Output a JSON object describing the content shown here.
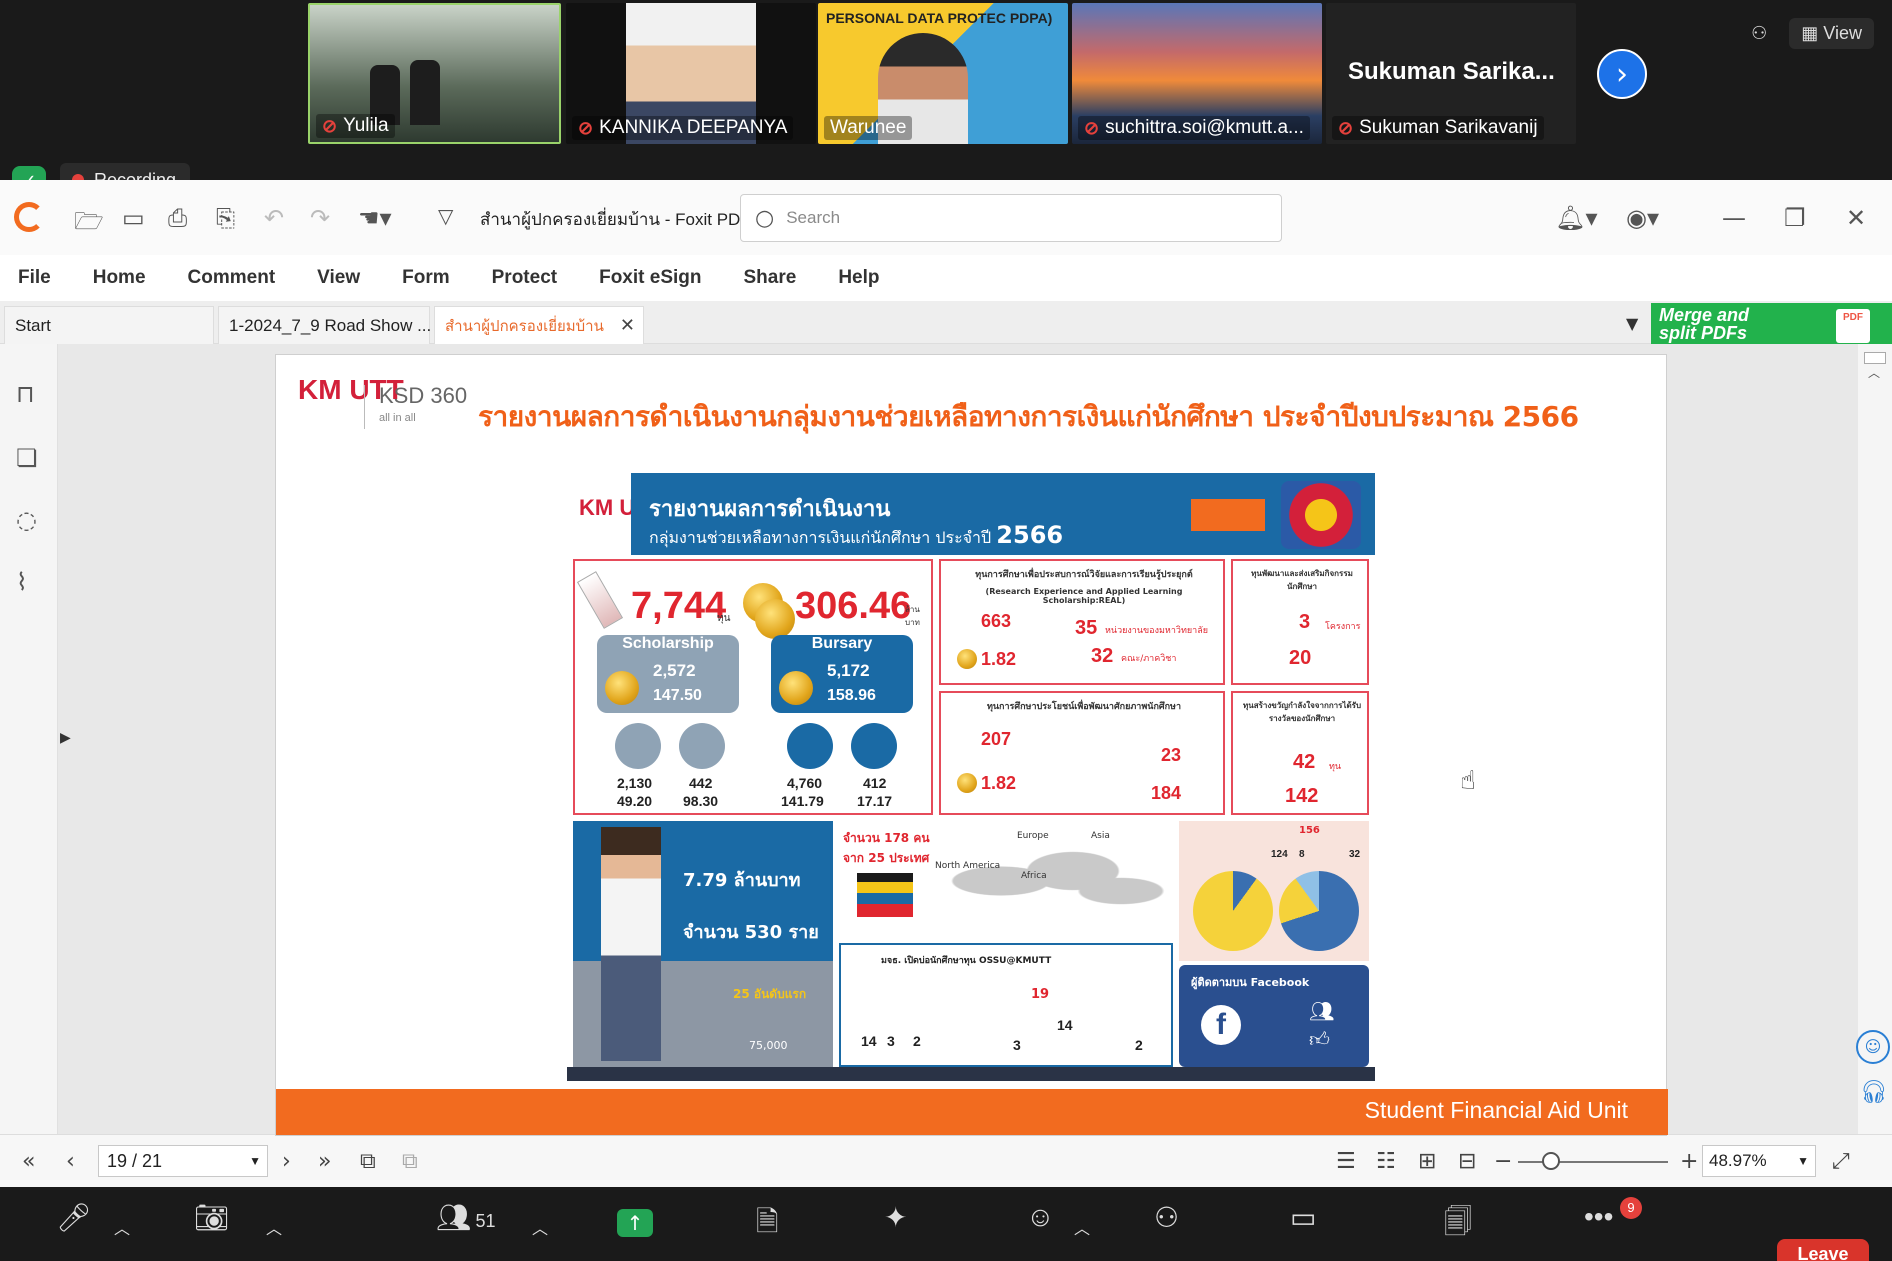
{
  "gallery": {
    "participants": [
      {
        "name": "Yulila"
      },
      {
        "name": "KANNIKA DEEPANYA"
      },
      {
        "name": "Warunee",
        "overlay": "PERSONAL DATA PROTEC PDPA)"
      },
      {
        "name": "suchittra.soi@kmutt.a..."
      },
      {
        "name": "Sukuman Sarikavanij",
        "display_name": "Sukuman  Sarika..."
      }
    ],
    "view_label": "View"
  },
  "recording": {
    "label": "Recording"
  },
  "app": {
    "doc_title": "สำนาผู้ปกครองเยี่ยมบ้าน - Foxit PDF...",
    "search_placeholder": "Search"
  },
  "menu": [
    "File",
    "Home",
    "Comment",
    "View",
    "Form",
    "Protect",
    "Foxit eSign",
    "Share",
    "Help"
  ],
  "tabs": [
    {
      "label": "Start"
    },
    {
      "label": "1-2024_7_9 Road Show ..."
    },
    {
      "label": "สำนาผู้ปกครองเยี่ยมบ้าน",
      "active": true
    }
  ],
  "promo": {
    "line1": "Merge and",
    "line2": "split PDFs",
    "icon_text": "PDF"
  },
  "page": {
    "kmutt_logo": "KM UTT",
    "ksd_logo": "KSD 360",
    "ksd_tagline": "all in all",
    "heading": "รายงานผลการดำเนินงานกลุ่มงานช่วยเหลือทางการเงินแก่นักศึกษา ประจำปีงบประมาณ 2566",
    "footer": "Student Financial Aid Unit"
  },
  "infographic": {
    "logo": "KM UTT",
    "banner_title": "รายงานผลการดำเนินงาน",
    "banner_sub": "กลุ่มงานช่วยเหลือทางการเงินแก่นักศึกษา ประจำปี",
    "banner_year": "2566",
    "total_count": "7,744",
    "total_unit": "ทุน",
    "total_amount": "306.46",
    "amount_unit": "ล้านบาท",
    "scholarship": {
      "label": "Scholarship",
      "count": "2,572",
      "amount": "147.50"
    },
    "bursary": {
      "label": "Bursary",
      "count": "5,172",
      "amount": "158.96"
    },
    "scholar_split": [
      {
        "count": "2,130",
        "amount": "49.20"
      },
      {
        "count": "442",
        "amount": "98.30"
      }
    ],
    "bursary_split": [
      {
        "count": "4,760",
        "amount": "141.79"
      },
      {
        "count": "412",
        "amount": "17.17"
      }
    ],
    "real": {
      "title": "ทุนการศึกษาเพื่อประสบการณ์วิจัยและการเรียนรู้ประยุกต์",
      "subtitle": "(Research Experience and Applied Learning Scholarship:REAL)",
      "count": "663",
      "amount": "1.82",
      "units": "35",
      "units_label": "หน่วยงานของมหาวิทยาลัย",
      "depts": "32",
      "depts_label": "คณะ/ภาควิชา"
    },
    "talent": {
      "title": "ทุนการศึกษาประโยชน์เพื่อพัฒนาศักยภาพนักศึกษา",
      "count": "207",
      "amount": "1.82",
      "activities": "23",
      "rewards": "184"
    },
    "develop": {
      "title": "ทุนพัฒนาและส่งเสริมกิจกรรมนักศึกษา",
      "a": "3",
      "b": "20",
      "unit": "โครงการ"
    },
    "motivation": {
      "title": "ทุนสร้างขวัญกำลังใจจากการได้รับรางวัลของนักศึกษา",
      "a": "42",
      "b": "142",
      "unit": "ทุน"
    },
    "loan": {
      "amount": "7.79 ล้านบาท",
      "people": "จำนวน 530 ราย",
      "debt": "25 อันดับแรก",
      "total": "75,000"
    },
    "intl": {
      "students": "จำนวน 178 คน",
      "countries": "จาก 25 ประเทศ",
      "regions": [
        "North America",
        "Europe",
        "Asia",
        "Africa"
      ]
    },
    "club": {
      "title": "มจธ. เปิดบ่อนักศึกษาทุน OSSU@KMUTT",
      "count": "19",
      "a": "14",
      "b": "3",
      "c": "2",
      "d": "14",
      "e": "3",
      "f": "2"
    },
    "survey": {
      "count": "156",
      "pie1": [
        "124",
        "8"
      ],
      "pie2": [
        "32"
      ]
    },
    "facebook": {
      "label": "ผู้ติดตามบน Facebook"
    }
  },
  "statusbar": {
    "page": "19 / 21",
    "zoom": "48.97%"
  },
  "zoom_controls": {
    "participants_count": "51",
    "more_badge": "9",
    "leave_label": "Leave"
  },
  "colors": {
    "accent_orange": "#f26b1f",
    "kmutt_red": "#d3203a",
    "banner_blue": "#1a6aa5",
    "zoom_green": "#23a455"
  }
}
